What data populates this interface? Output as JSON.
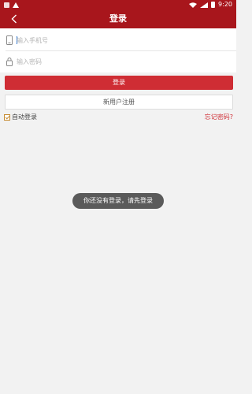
{
  "status_bar": {
    "time": "9:20"
  },
  "app_bar": {
    "title": "登录"
  },
  "form": {
    "phone_placeholder": "输入手机号",
    "password_placeholder": "输入密码"
  },
  "buttons": {
    "login": "登录",
    "register": "新用户注册"
  },
  "options": {
    "auto_login": "自动登录",
    "auto_login_checked": true,
    "forgot_password": "忘记密码?"
  },
  "toast": {
    "message": "你还没有登录，请先登录"
  },
  "colors": {
    "primary": "#a8161c",
    "button": "#cf2d34",
    "background": "#f2f2f2"
  }
}
